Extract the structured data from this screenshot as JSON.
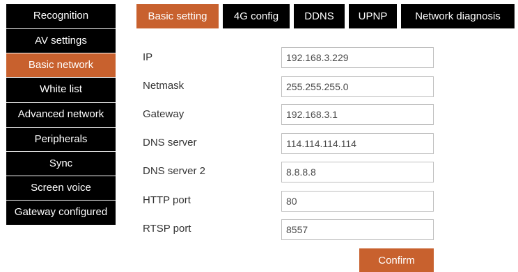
{
  "sidebar": {
    "items": [
      {
        "label": "Recognition"
      },
      {
        "label": "AV settings"
      },
      {
        "label": "Basic network"
      },
      {
        "label": "White list"
      },
      {
        "label": "Advanced network"
      },
      {
        "label": "Peripherals"
      },
      {
        "label": "Sync"
      },
      {
        "label": "Screen voice"
      },
      {
        "label": "Gateway configured"
      }
    ],
    "active_index": 2
  },
  "tabs": [
    {
      "label": "Basic setting"
    },
    {
      "label": "4G config"
    },
    {
      "label": "DDNS"
    },
    {
      "label": "UPNP"
    },
    {
      "label": "Network diagnosis"
    }
  ],
  "active_tab_index": 0,
  "form": {
    "fields": [
      {
        "label": "IP",
        "value": "192.168.3.229"
      },
      {
        "label": "Netmask",
        "value": "255.255.255.0"
      },
      {
        "label": "Gateway",
        "value": "192.168.3.1"
      },
      {
        "label": "DNS server",
        "value": "114.114.114.114"
      },
      {
        "label": "DNS server 2",
        "value": "8.8.8.8"
      },
      {
        "label": "HTTP port",
        "value": "80"
      },
      {
        "label": "RTSP port",
        "value": "8557"
      }
    ],
    "confirm_label": "Confirm"
  },
  "colors": {
    "accent": "#c8612e",
    "nav_background": "#000000",
    "nav_text": "#ffffff"
  }
}
